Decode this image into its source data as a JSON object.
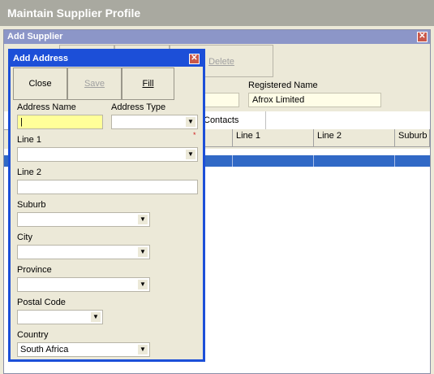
{
  "main_window": {
    "title": "Maintain Supplier Profile"
  },
  "supplier_window": {
    "title": "Add Supplier",
    "toolbar": {
      "delete_label": "Delete"
    },
    "registered_name_label": "Registered Name",
    "registered_name_value": "Afrox Limited",
    "tabs": {
      "contacts": "Contacts"
    },
    "grid_columns": [
      "Line 1",
      "Line 2",
      "Suburb"
    ]
  },
  "address_dialog": {
    "title": "Add Address",
    "buttons": {
      "close": "Close",
      "save": "Save",
      "fill": "Fill"
    },
    "address_name_label": "Address Name",
    "address_type_label": "Address Type",
    "line1_label": "Line 1",
    "line2_label": "Line 2",
    "suburb_label": "Suburb",
    "city_label": "City",
    "province_label": "Province",
    "postal_code_label": "Postal Code",
    "country_label": "Country",
    "country_value": "South Africa"
  },
  "colors": {
    "dialog_border": "#1c4fd8",
    "selected_row": "#3169c6",
    "required_field": "#ffff99"
  }
}
